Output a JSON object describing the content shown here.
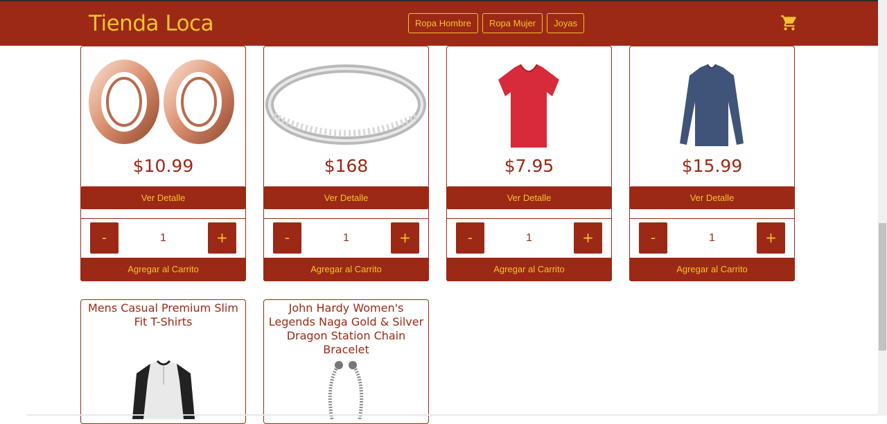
{
  "header": {
    "brand": "Tienda Loca",
    "nav": [
      "Ropa Hombre",
      "Ropa Mujer",
      "Joyas"
    ]
  },
  "colors": {
    "primary": "#9b2915",
    "accent": "#f5c32c"
  },
  "products": [
    {
      "price": "$10.99",
      "detail_label": "Ver Detalle",
      "quantity": "1",
      "minus": "-",
      "plus": "+",
      "add_label": "Agregar al Carrito",
      "image": "rose-gold-ear-tunnels"
    },
    {
      "price": "$168",
      "detail_label": "Ver Detalle",
      "quantity": "1",
      "minus": "-",
      "plus": "+",
      "add_label": "Agregar al Carrito",
      "image": "silver-diamond-ring"
    },
    {
      "price": "$7.95",
      "detail_label": "Ver Detalle",
      "quantity": "1",
      "minus": "-",
      "plus": "+",
      "add_label": "Agregar al Carrito",
      "image": "red-women-tshirt"
    },
    {
      "price": "$15.99",
      "detail_label": "Ver Detalle",
      "quantity": "1",
      "minus": "-",
      "plus": "+",
      "add_label": "Agregar al Carrito",
      "image": "blue-long-sleeve-shirt"
    }
  ],
  "products_partial": [
    {
      "title": "Mens Casual Premium Slim Fit T-Shirts",
      "image": "raglan-henley-shirt"
    },
    {
      "title": "John Hardy Women's Legends Naga Gold & Silver Dragon Station Chain Bracelet",
      "image": "dragon-chain-bracelet"
    }
  ]
}
